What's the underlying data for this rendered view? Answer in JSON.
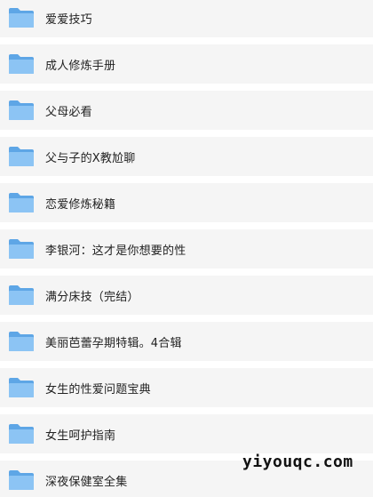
{
  "folders": [
    {
      "label": "爱爱技巧",
      "icon": "folder-icon"
    },
    {
      "label": "成人修炼手册",
      "icon": "folder-icon"
    },
    {
      "label": "父母必看",
      "icon": "folder-icon"
    },
    {
      "label": "父与子的X教尬聊",
      "icon": "folder-icon"
    },
    {
      "label": "恋爱修炼秘籍",
      "icon": "folder-icon"
    },
    {
      "label": "李银河：这才是你想要的性",
      "icon": "folder-icon"
    },
    {
      "label": "满分床技（完结）",
      "icon": "folder-icon"
    },
    {
      "label": "美丽芭蕾孕期特辑。4合辑",
      "icon": "folder-icon"
    },
    {
      "label": "女生的性爱问题宝典",
      "icon": "folder-icon"
    },
    {
      "label": "女生呵护指南",
      "icon": "folder-icon"
    },
    {
      "label": "深夜保健室全集",
      "icon": "folder-icon"
    }
  ],
  "watermark": "yiyouqc.com",
  "colors": {
    "row_background": "#f5f5f5",
    "folder_back": "#6aaeea",
    "folder_front": "#8cc4f4",
    "text": "#222222"
  }
}
